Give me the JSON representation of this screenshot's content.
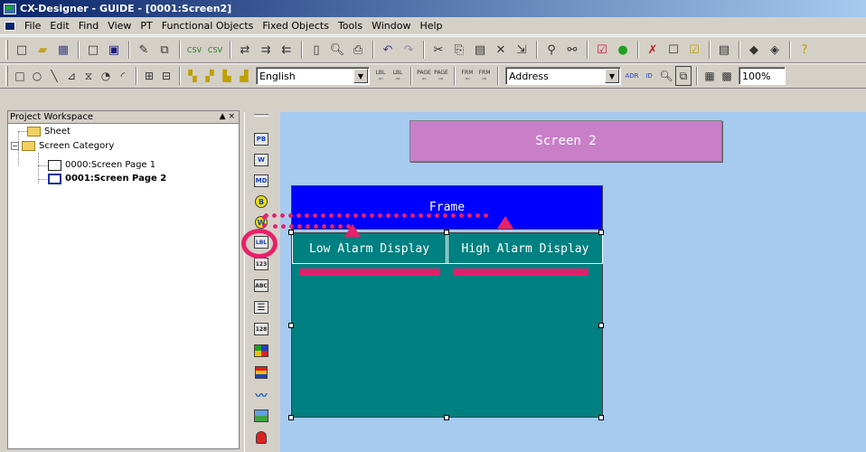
{
  "window": {
    "title": "CX-Designer - GUIDE - [0001:Screen2]"
  },
  "menu": {
    "items": [
      "File",
      "Edit",
      "Find",
      "View",
      "PT",
      "Functional Objects",
      "Fixed Objects",
      "Tools",
      "Window",
      "Help"
    ]
  },
  "toolbar": {
    "language": "English",
    "address_mode": "Address",
    "zoom": "100%",
    "lbl1": "LBL",
    "lbl2": "LBL",
    "page1": "PAGE",
    "page2": "PAGE",
    "frm1": "FRM",
    "frm2": "FRM",
    "adr": "ADR",
    "id": "ID"
  },
  "workspace": {
    "title": "Project Workspace",
    "controls": "▲ ×",
    "tree": {
      "sheet": "Sheet",
      "screen_category": "Screen Category",
      "page1": "0000:Screen Page 1",
      "page2": "0001:Screen Page 2"
    }
  },
  "object_bar": {
    "pb": "PB",
    "w": "W",
    "md": "MD",
    "b": "B",
    "wl": "W",
    "lbl": "LBL",
    "num": "123",
    "abc": "ABC",
    "n128": "128"
  },
  "canvas": {
    "screen_label": "Screen 2",
    "frame_label": "Frame",
    "tabs": [
      "Low Alarm Display",
      "High Alarm Display"
    ]
  },
  "annotation": {
    "color": "#e8206a"
  }
}
